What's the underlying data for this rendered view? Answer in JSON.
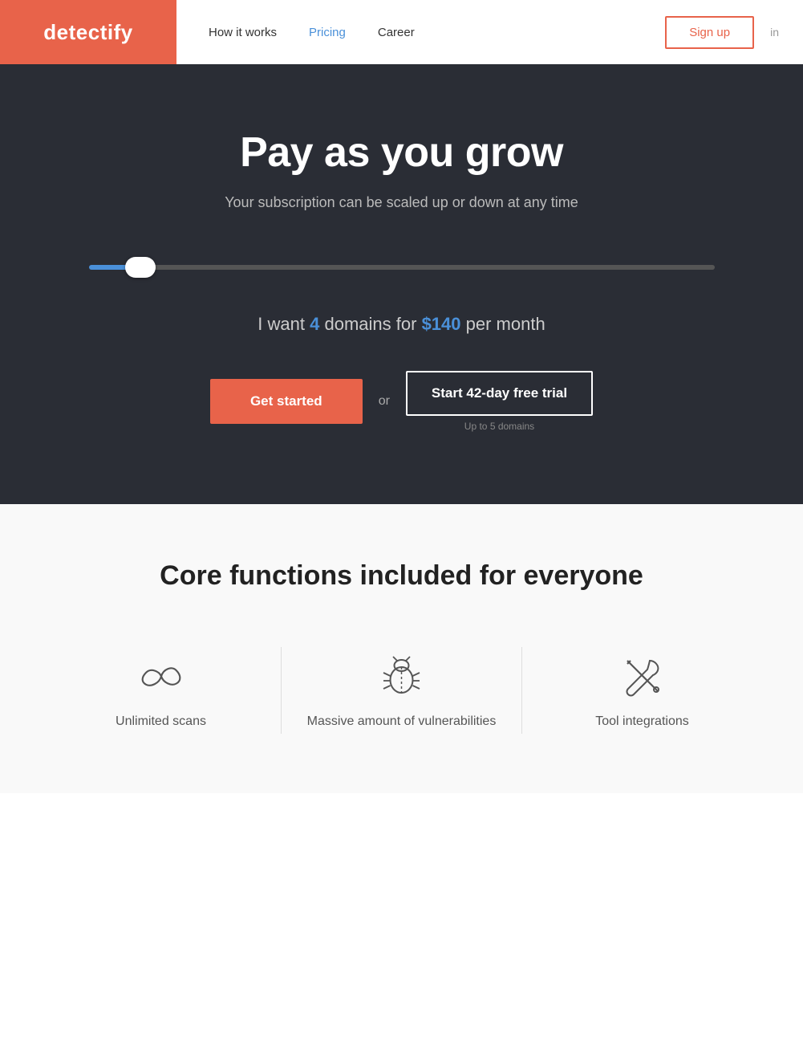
{
  "header": {
    "logo": "detectify",
    "nav": [
      {
        "label": "How it works",
        "active": false
      },
      {
        "label": "Pricing",
        "active": true
      },
      {
        "label": "Career",
        "active": false
      }
    ],
    "sign_up_label": "Sign up",
    "sign_in_label": "in"
  },
  "hero": {
    "title": "Pay as you grow",
    "subtitle": "Your subscription can be scaled up or down at any time",
    "slider": {
      "value": 4,
      "min": 1,
      "max": 50
    },
    "pricing_text_prefix": "I want",
    "pricing_domains_num": "4",
    "pricing_text_mid": "domains for",
    "pricing_price": "$140",
    "pricing_text_suffix": "per month",
    "get_started_label": "Get started",
    "or_label": "or",
    "free_trial_label": "Start 42-day free trial",
    "free_trial_note": "Up to 5 domains"
  },
  "features": {
    "title": "Core functions included for everyone",
    "items": [
      {
        "icon": "infinity-icon",
        "label": "Unlimited scans"
      },
      {
        "icon": "bug-icon",
        "label": "Massive amount of vulnerabilities"
      },
      {
        "icon": "tools-icon",
        "label": "Tool integrations"
      }
    ]
  },
  "colors": {
    "accent_red": "#e8634a",
    "accent_blue": "#4a90d9",
    "dark_bg": "#2a2d35",
    "text_light": "#bbb"
  }
}
